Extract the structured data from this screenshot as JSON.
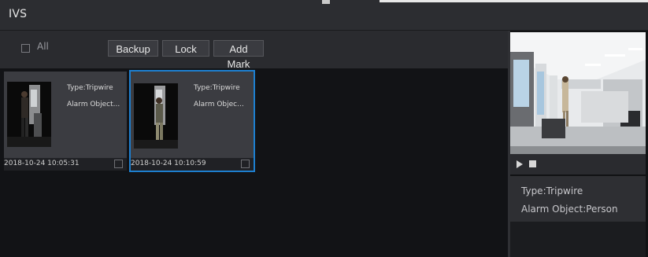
{
  "window": {
    "title": "IVS"
  },
  "toolbar": {
    "all_label": "All",
    "backup_label": "Backup",
    "lock_label": "Lock",
    "add_mark_label": "Add Mark"
  },
  "records": [
    {
      "type": "Type:Tripwire",
      "alarm": "Alarm Object...",
      "timestamp": "2018-10-24 10:05:31",
      "selected": false
    },
    {
      "type": "Type:Tripwire",
      "alarm": "Alarm Objec...",
      "timestamp": "2018-10-24 10:10:59",
      "selected": true
    }
  ],
  "preview": {
    "type_text": "Type:Tripwire",
    "alarm_text": "Alarm Object:Person"
  },
  "colors": {
    "accent": "#1d7fcf",
    "background": "#111214",
    "panel": "#2a2b2f"
  },
  "icons": [
    "play-icon",
    "stop-icon",
    "checkbox-icon"
  ]
}
